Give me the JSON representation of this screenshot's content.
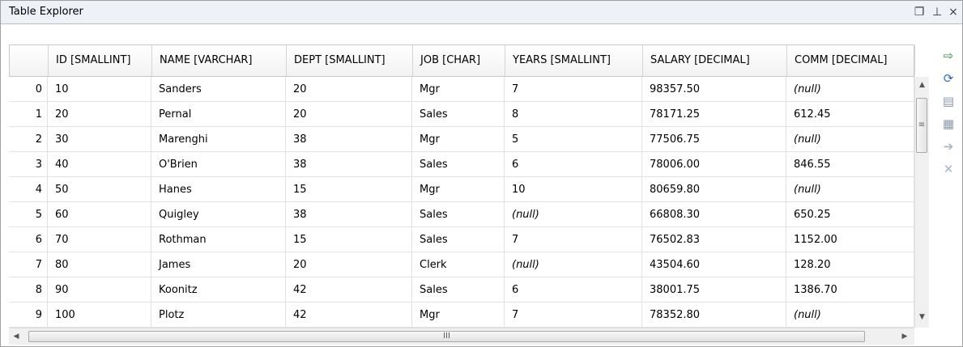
{
  "window": {
    "title": "Table Explorer",
    "controls": {
      "restore": "❐",
      "pin": "⊥",
      "close": "×"
    }
  },
  "table": {
    "columns": [
      "",
      "ID [SMALLINT]",
      "NAME [VARCHAR]",
      "DEPT [SMALLINT]",
      "JOB [CHAR]",
      "YEARS [SMALLINT]",
      "SALARY [DECIMAL]",
      "COMM [DECIMAL]"
    ],
    "rows": [
      [
        "0",
        "10",
        "Sanders",
        "20",
        "Mgr",
        "7",
        "98357.50",
        "(null)"
      ],
      [
        "1",
        "20",
        "Pernal",
        "20",
        "Sales",
        "8",
        "78171.25",
        "612.45"
      ],
      [
        "2",
        "30",
        "Marenghi",
        "38",
        "Mgr",
        "5",
        "77506.75",
        "(null)"
      ],
      [
        "3",
        "40",
        "O'Brien",
        "38",
        "Sales",
        "6",
        "78006.00",
        "846.55"
      ],
      [
        "4",
        "50",
        "Hanes",
        "15",
        "Mgr",
        "10",
        "80659.80",
        "(null)"
      ],
      [
        "5",
        "60",
        "Quigley",
        "38",
        "Sales",
        "(null)",
        "66808.30",
        "650.25"
      ],
      [
        "6",
        "70",
        "Rothman",
        "15",
        "Sales",
        "7",
        "76502.83",
        "1152.00"
      ],
      [
        "7",
        "80",
        "James",
        "20",
        "Clerk",
        "(null)",
        "43504.60",
        "128.20"
      ],
      [
        "8",
        "90",
        "Koonitz",
        "42",
        "Sales",
        "6",
        "38001.75",
        "1386.70"
      ],
      [
        "9",
        "100",
        "Plotz",
        "42",
        "Mgr",
        "7",
        "78352.80",
        "(null)"
      ]
    ]
  },
  "scrollbars": {
    "up": "▲",
    "down": "▼",
    "left": "◀",
    "right": "▶",
    "grip_v": "≡",
    "grip_h": "III"
  },
  "side_tools": [
    {
      "name": "export-icon",
      "glyph": "⇨",
      "color": "#2b8a3e"
    },
    {
      "name": "refresh-icon",
      "glyph": "⟳",
      "color": "#2f6fc0"
    },
    {
      "name": "insert-row-icon",
      "glyph": "▤",
      "color": "#8a99ad"
    },
    {
      "name": "duplicate-row-icon",
      "glyph": "▦",
      "color": "#8a99ad"
    },
    {
      "name": "commit-icon",
      "glyph": "➔",
      "color": "#a9b6c6"
    },
    {
      "name": "delete-icon",
      "glyph": "✕",
      "color": "#a9b6c6"
    }
  ]
}
